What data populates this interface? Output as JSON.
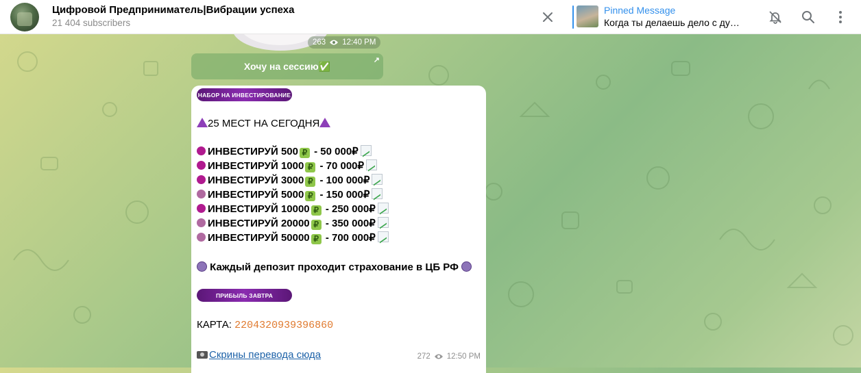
{
  "header": {
    "channel_title": "Цифровой Предприниматель|Вибрации успеха",
    "subscribers": "21 404 subscribers",
    "pinned_title": "Pinned Message",
    "pinned_text": "Когда ты делаешь дело с ду…",
    "icons": [
      "close-icon",
      "bell-muted-icon",
      "search-icon",
      "more-vertical-icon"
    ]
  },
  "prev_message": {
    "views": "263",
    "time": "12:40 PM",
    "button_label": "Хочу на сессию✅"
  },
  "message": {
    "tag1": "НАБОР НА ИНВЕСТИРОВАНИЕ",
    "headline": "25 МЕСТ НА СЕГОДНЯ",
    "rows": [
      {
        "text": "ИНВЕСТИРУЙ 500",
        "result": " -  50 000₽",
        "dot": "#b01a8f"
      },
      {
        "text": "ИНВЕСТИРУЙ 1000",
        "result": " - 70 000₽",
        "dot": "#b01a8f"
      },
      {
        "text": "ИНВЕСТИРУЙ 3000",
        "result": " - 100 000₽",
        "dot": "#b01a8f"
      },
      {
        "text": "ИНВЕСТИРУЙ 5000",
        "result": " - 150 000₽",
        "dot": "#b06aa0"
      },
      {
        "text": "ИНВЕСТИРУЙ 10000",
        "result": " - 250 000₽",
        "dot": "#b01a8f"
      },
      {
        "text": "ИНВЕСТИРУЙ 20000",
        "result": " - 350 000₽",
        "dot": "#b06aa0"
      },
      {
        "text": "ИНВЕСТИРУЙ 50000",
        "result": " - 700 000₽",
        "dot": "#b06aa0"
      }
    ],
    "insurance": "Каждый депозит проходит страхование в ЦБ РФ",
    "tag2": "ПРИБЫЛЬ ЗАВТРА",
    "card_label": "КАРТА: ",
    "card_number": "2204320939396860",
    "screens_link": "Скрины перевода сюда",
    "views": "272",
    "time": "12:50 PM"
  }
}
